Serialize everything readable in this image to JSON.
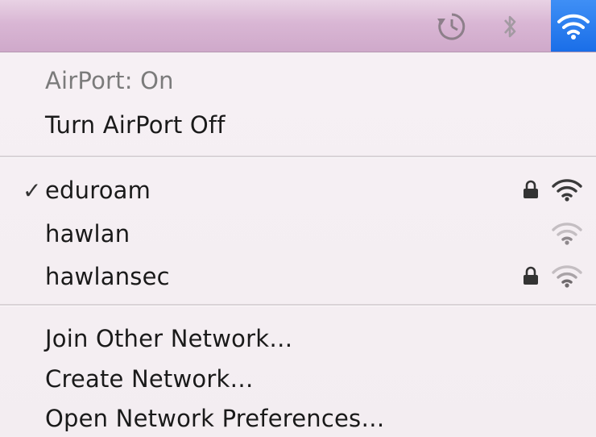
{
  "menubar": {
    "icons": [
      "time-machine-icon",
      "bluetooth-icon",
      "wifi-icon"
    ]
  },
  "menu": {
    "status": "AirPort: On",
    "toggle": "Turn AirPort Off",
    "networks": [
      {
        "name": "eduroam",
        "selected": true,
        "secured": true,
        "signal": "strong"
      },
      {
        "name": "hawlan",
        "selected": false,
        "secured": false,
        "signal": "weak"
      },
      {
        "name": "hawlansec",
        "selected": false,
        "secured": true,
        "signal": "weak"
      }
    ],
    "checkmark": "✓",
    "join_other": "Join Other Network…",
    "create": "Create Network…",
    "preferences": "Open Network Preferences…"
  },
  "colors": {
    "menubar": "#d9b6d4",
    "selected_menubar_item": "#1a6ee8",
    "menu_bg": "#f4eef2"
  }
}
